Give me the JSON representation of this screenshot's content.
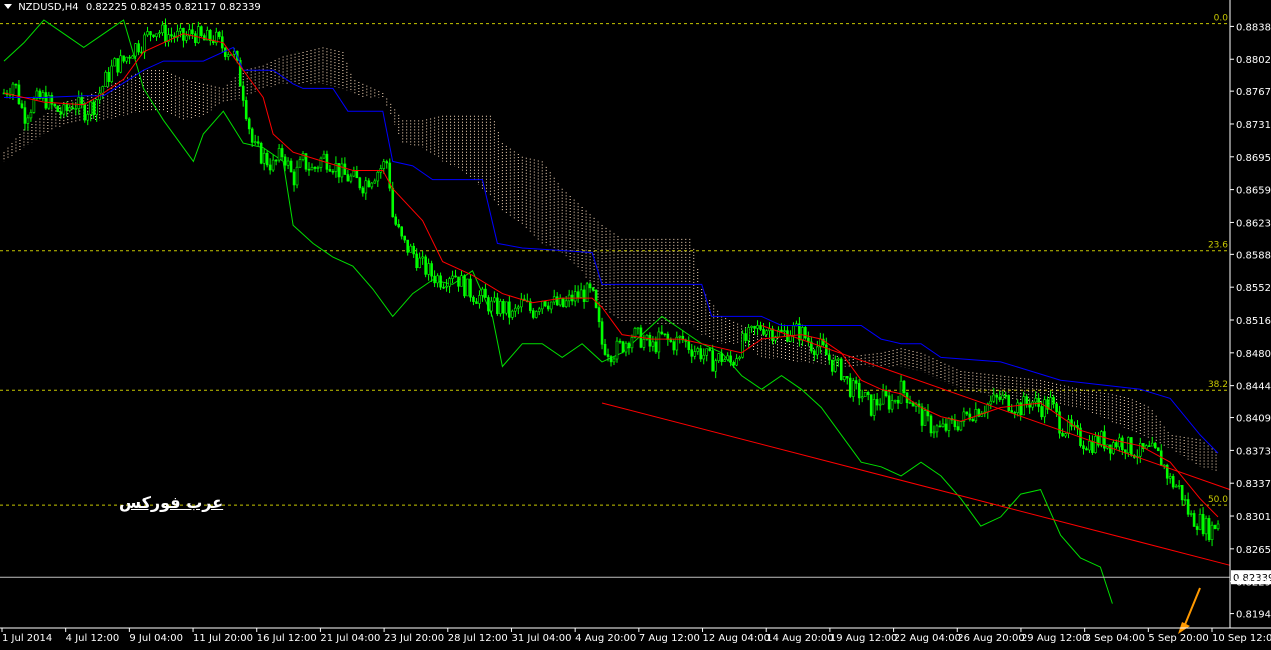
{
  "header": {
    "symbol": "NZDUSD,H4",
    "ohlc": "0.82225 0.82435 0.82117 0.82339"
  },
  "watermark": "عرب فوركس",
  "colors": {
    "background": "#000000",
    "candles": "#00ff00",
    "tenkan": "#ff0000",
    "kijun": "#0000ff",
    "chikou": "#00e000",
    "kumo": "#ffe0c0",
    "fib": "#c8c800",
    "channel": "#ff0000",
    "arrow": "#ff9900",
    "price_line": "#c0c0c0"
  },
  "chart_data": {
    "type": "candlestick",
    "title": "",
    "xlabel": "",
    "ylabel": "",
    "ylim": [
      0.8176,
      0.8856
    ],
    "y_ticks": [
      "0.88380",
      "0.88020",
      "0.87670",
      "0.87310",
      "0.86950",
      "0.86590",
      "0.86230",
      "0.85880",
      "0.85520",
      "0.85160",
      "0.84800",
      "0.84440",
      "0.84090",
      "0.83730",
      "0.83370",
      "0.83010",
      "0.82650",
      "0.82290",
      "0.81940"
    ],
    "x_ticks": [
      "1 Jul 2014",
      "4 Jul 12:00",
      "9 Jul 04:00",
      "11 Jul 20:00",
      "16 Jul 12:00",
      "21 Jul 04:00",
      "23 Jul 20:00",
      "28 Jul 12:00",
      "31 Jul 04:00",
      "4 Aug 20:00",
      "7 Aug 12:00",
      "12 Aug 04:00",
      "14 Aug 20:00",
      "19 Aug 12:00",
      "22 Aug 04:00",
      "26 Aug 20:00",
      "29 Aug 12:00",
      "3 Sep 04:00",
      "5 Sep 20:00",
      "10 Sep 12:00"
    ],
    "current_price": "0.82339",
    "fib_levels": [
      {
        "label": "0.0",
        "value": 0.8841
      },
      {
        "label": "23.6",
        "value": 0.8592
      },
      {
        "label": "38.2",
        "value": 0.8439
      },
      {
        "label": "50.0",
        "value": 0.8313
      }
    ],
    "close_path": [
      [
        0,
        0.8765
      ],
      [
        10,
        0.8778
      ],
      [
        20,
        0.874
      ],
      [
        30,
        0.8755
      ],
      [
        40,
        0.876
      ],
      [
        50,
        0.8748
      ],
      [
        60,
        0.8742
      ],
      [
        70,
        0.8755
      ],
      [
        80,
        0.8745
      ],
      [
        90,
        0.8752
      ],
      [
        100,
        0.8775
      ],
      [
        110,
        0.8795
      ],
      [
        120,
        0.88
      ],
      [
        130,
        0.8815
      ],
      [
        140,
        0.8822
      ],
      [
        150,
        0.8836
      ],
      [
        160,
        0.883
      ],
      [
        170,
        0.8828
      ],
      [
        180,
        0.8824
      ],
      [
        190,
        0.8832
      ],
      [
        200,
        0.8822
      ],
      [
        210,
        0.8826
      ],
      [
        220,
        0.8815
      ],
      [
        230,
        0.881
      ],
      [
        240,
        0.8765
      ],
      [
        250,
        0.8705
      ],
      [
        260,
        0.8695
      ],
      [
        270,
        0.8685
      ],
      [
        280,
        0.87
      ],
      [
        290,
        0.867
      ],
      [
        300,
        0.869
      ],
      [
        310,
        0.868
      ],
      [
        320,
        0.8695
      ],
      [
        330,
        0.8688
      ],
      [
        340,
        0.8675
      ],
      [
        350,
        0.867
      ],
      [
        360,
        0.8665
      ],
      [
        370,
        0.8675
      ],
      [
        380,
        0.8685
      ],
      [
        385,
        0.869
      ],
      [
        390,
        0.863
      ],
      [
        400,
        0.86
      ],
      [
        410,
        0.859
      ],
      [
        420,
        0.8575
      ],
      [
        430,
        0.8565
      ],
      [
        440,
        0.856
      ],
      [
        450,
        0.857
      ],
      [
        460,
        0.8555
      ],
      [
        470,
        0.8545
      ],
      [
        480,
        0.854
      ],
      [
        490,
        0.853
      ],
      [
        500,
        0.853
      ],
      [
        510,
        0.852
      ],
      [
        520,
        0.8535
      ],
      [
        530,
        0.8525
      ],
      [
        540,
        0.854
      ],
      [
        550,
        0.8535
      ],
      [
        560,
        0.853
      ],
      [
        570,
        0.854
      ],
      [
        580,
        0.8545
      ],
      [
        590,
        0.8545
      ],
      [
        600,
        0.849
      ],
      [
        610,
        0.848
      ],
      [
        620,
        0.8488
      ],
      [
        630,
        0.85
      ],
      [
        640,
        0.8495
      ],
      [
        650,
        0.8485
      ],
      [
        660,
        0.8497
      ],
      [
        670,
        0.849
      ],
      [
        680,
        0.8495
      ],
      [
        690,
        0.8485
      ],
      [
        700,
        0.848
      ],
      [
        710,
        0.847
      ],
      [
        720,
        0.8475
      ],
      [
        730,
        0.8468
      ],
      [
        740,
        0.849
      ],
      [
        750,
        0.85
      ],
      [
        760,
        0.851
      ],
      [
        770,
        0.8505
      ],
      [
        780,
        0.85
      ],
      [
        790,
        0.8505
      ],
      [
        800,
        0.8502
      ],
      [
        810,
        0.849
      ],
      [
        820,
        0.8485
      ],
      [
        830,
        0.847
      ],
      [
        840,
        0.846
      ],
      [
        850,
        0.844
      ],
      [
        860,
        0.8435
      ],
      [
        870,
        0.842
      ],
      [
        880,
        0.843
      ],
      [
        890,
        0.8425
      ],
      [
        900,
        0.844
      ],
      [
        910,
        0.843
      ],
      [
        920,
        0.841
      ],
      [
        930,
        0.84
      ],
      [
        940,
        0.8395
      ],
      [
        950,
        0.84
      ],
      [
        960,
        0.8405
      ],
      [
        970,
        0.8415
      ],
      [
        980,
        0.842
      ],
      [
        990,
        0.8425
      ],
      [
        1000,
        0.843
      ],
      [
        1010,
        0.8425
      ],
      [
        1020,
        0.842
      ],
      [
        1030,
        0.8428
      ],
      [
        1040,
        0.842
      ],
      [
        1050,
        0.8425
      ],
      [
        1060,
        0.84
      ],
      [
        1070,
        0.8395
      ],
      [
        1080,
        0.8385
      ],
      [
        1090,
        0.838
      ],
      [
        1100,
        0.8385
      ],
      [
        1110,
        0.838
      ],
      [
        1120,
        0.8384
      ],
      [
        1130,
        0.8375
      ],
      [
        1140,
        0.837
      ],
      [
        1150,
        0.8372
      ],
      [
        1160,
        0.8365
      ],
      [
        1170,
        0.834
      ],
      [
        1180,
        0.833
      ],
      [
        1190,
        0.83
      ],
      [
        1200,
        0.8295
      ],
      [
        1210,
        0.8285
      ],
      [
        1218,
        0.8295
      ]
    ],
    "tenkan": [
      [
        0,
        0.8765
      ],
      [
        40,
        0.8755
      ],
      [
        80,
        0.8752
      ],
      [
        100,
        0.8765
      ],
      [
        120,
        0.878
      ],
      [
        140,
        0.881
      ],
      [
        180,
        0.883
      ],
      [
        220,
        0.882
      ],
      [
        240,
        0.879
      ],
      [
        260,
        0.876
      ],
      [
        270,
        0.872
      ],
      [
        290,
        0.87
      ],
      [
        320,
        0.869
      ],
      [
        350,
        0.868
      ],
      [
        380,
        0.868
      ],
      [
        390,
        0.866
      ],
      [
        420,
        0.8625
      ],
      [
        440,
        0.858
      ],
      [
        470,
        0.8565
      ],
      [
        500,
        0.8545
      ],
      [
        530,
        0.8535
      ],
      [
        560,
        0.854
      ],
      [
        590,
        0.854
      ],
      [
        600,
        0.853
      ],
      [
        620,
        0.85
      ],
      [
        650,
        0.8495
      ],
      [
        680,
        0.8495
      ],
      [
        700,
        0.849
      ],
      [
        740,
        0.848
      ],
      [
        760,
        0.8495
      ],
      [
        800,
        0.85
      ],
      [
        820,
        0.8495
      ],
      [
        840,
        0.848
      ],
      [
        860,
        0.845
      ],
      [
        880,
        0.844
      ],
      [
        900,
        0.8435
      ],
      [
        920,
        0.842
      ],
      [
        940,
        0.841
      ],
      [
        960,
        0.8405
      ],
      [
        1000,
        0.842
      ],
      [
        1040,
        0.8425
      ],
      [
        1060,
        0.841
      ],
      [
        1080,
        0.8395
      ],
      [
        1110,
        0.8385
      ],
      [
        1140,
        0.8378
      ],
      [
        1170,
        0.836
      ],
      [
        1200,
        0.832
      ],
      [
        1218,
        0.83
      ]
    ],
    "kijun": [
      [
        0,
        0.876
      ],
      [
        40,
        0.876
      ],
      [
        80,
        0.8762
      ],
      [
        100,
        0.8762
      ],
      [
        140,
        0.879
      ],
      [
        160,
        0.88
      ],
      [
        200,
        0.88
      ],
      [
        230,
        0.8815
      ],
      [
        240,
        0.879
      ],
      [
        270,
        0.879
      ],
      [
        290,
        0.8775
      ],
      [
        300,
        0.877
      ],
      [
        330,
        0.877
      ],
      [
        345,
        0.8745
      ],
      [
        380,
        0.8745
      ],
      [
        390,
        0.869
      ],
      [
        410,
        0.8685
      ],
      [
        430,
        0.867
      ],
      [
        480,
        0.867
      ],
      [
        495,
        0.86
      ],
      [
        520,
        0.8595
      ],
      [
        590,
        0.859
      ],
      [
        600,
        0.8555
      ],
      [
        700,
        0.8555
      ],
      [
        710,
        0.852
      ],
      [
        760,
        0.852
      ],
      [
        780,
        0.851
      ],
      [
        860,
        0.851
      ],
      [
        880,
        0.8495
      ],
      [
        900,
        0.849
      ],
      [
        920,
        0.849
      ],
      [
        940,
        0.8475
      ],
      [
        1000,
        0.847
      ],
      [
        1060,
        0.845
      ],
      [
        1100,
        0.8445
      ],
      [
        1140,
        0.844
      ],
      [
        1170,
        0.843
      ],
      [
        1200,
        0.839
      ],
      [
        1218,
        0.837
      ]
    ],
    "chikou": [
      [
        0,
        0.88
      ],
      [
        20,
        0.882
      ],
      [
        40,
        0.8845
      ],
      [
        60,
        0.883
      ],
      [
        80,
        0.8815
      ],
      [
        100,
        0.883
      ],
      [
        120,
        0.8845
      ],
      [
        140,
        0.877
      ],
      [
        160,
        0.8735
      ],
      [
        180,
        0.8705
      ],
      [
        190,
        0.869
      ],
      [
        200,
        0.872
      ],
      [
        220,
        0.8745
      ],
      [
        240,
        0.871
      ],
      [
        260,
        0.8705
      ],
      [
        280,
        0.869
      ],
      [
        290,
        0.862
      ],
      [
        310,
        0.86
      ],
      [
        330,
        0.8585
      ],
      [
        350,
        0.8575
      ],
      [
        370,
        0.855
      ],
      [
        390,
        0.852
      ],
      [
        410,
        0.8545
      ],
      [
        430,
        0.856
      ],
      [
        450,
        0.8555
      ],
      [
        470,
        0.857
      ],
      [
        490,
        0.852
      ],
      [
        500,
        0.8465
      ],
      [
        520,
        0.849
      ],
      [
        540,
        0.849
      ],
      [
        560,
        0.8475
      ],
      [
        580,
        0.849
      ],
      [
        600,
        0.847
      ],
      [
        620,
        0.848
      ],
      [
        640,
        0.85
      ],
      [
        660,
        0.852
      ],
      [
        680,
        0.8505
      ],
      [
        700,
        0.849
      ],
      [
        720,
        0.848
      ],
      [
        740,
        0.8455
      ],
      [
        760,
        0.844
      ],
      [
        780,
        0.8455
      ],
      [
        800,
        0.844
      ],
      [
        820,
        0.842
      ],
      [
        840,
        0.839
      ],
      [
        860,
        0.836
      ],
      [
        880,
        0.8355
      ],
      [
        900,
        0.8345
      ],
      [
        920,
        0.836
      ],
      [
        940,
        0.8345
      ],
      [
        960,
        0.832
      ],
      [
        980,
        0.829
      ],
      [
        1000,
        0.83
      ],
      [
        1020,
        0.8325
      ],
      [
        1040,
        0.833
      ],
      [
        1060,
        0.828
      ],
      [
        1080,
        0.8255
      ],
      [
        1100,
        0.8245
      ],
      [
        1112,
        0.8205
      ]
    ],
    "kumo": [
      [
        0,
        0.869,
        0.87
      ],
      [
        20,
        0.8705,
        0.8725
      ],
      [
        40,
        0.872,
        0.874
      ],
      [
        60,
        0.873,
        0.8755
      ],
      [
        80,
        0.8735,
        0.876
      ],
      [
        100,
        0.8735,
        0.877
      ],
      [
        120,
        0.874,
        0.878
      ],
      [
        140,
        0.8745,
        0.879
      ],
      [
        160,
        0.8745,
        0.879
      ],
      [
        180,
        0.8735,
        0.878
      ],
      [
        200,
        0.874,
        0.8775
      ],
      [
        220,
        0.8755,
        0.877
      ],
      [
        240,
        0.876,
        0.879
      ],
      [
        260,
        0.877,
        0.8795
      ],
      [
        280,
        0.8775,
        0.8805
      ],
      [
        300,
        0.8775,
        0.881
      ],
      [
        320,
        0.8775,
        0.8815
      ],
      [
        340,
        0.877,
        0.881
      ],
      [
        350,
        0.8765,
        0.878
      ],
      [
        360,
        0.876,
        0.8775
      ],
      [
        380,
        0.876,
        0.8765
      ],
      [
        400,
        0.871,
        0.8735
      ],
      [
        420,
        0.8705,
        0.8735
      ],
      [
        440,
        0.869,
        0.874
      ],
      [
        460,
        0.868,
        0.874
      ],
      [
        490,
        0.865,
        0.874
      ],
      [
        500,
        0.8635,
        0.871
      ],
      [
        520,
        0.862,
        0.8695
      ],
      [
        540,
        0.86,
        0.869
      ],
      [
        560,
        0.859,
        0.866
      ],
      [
        580,
        0.857,
        0.864
      ],
      [
        600,
        0.853,
        0.862
      ],
      [
        620,
        0.8515,
        0.8605
      ],
      [
        660,
        0.851,
        0.8605
      ],
      [
        690,
        0.851,
        0.8605
      ],
      [
        700,
        0.85,
        0.855
      ],
      [
        720,
        0.849,
        0.852
      ],
      [
        740,
        0.849,
        0.851
      ],
      [
        760,
        0.8475,
        0.85
      ],
      [
        800,
        0.847,
        0.849
      ],
      [
        840,
        0.8465,
        0.8475
      ],
      [
        880,
        0.8465,
        0.848
      ],
      [
        900,
        0.8465,
        0.8485
      ],
      [
        920,
        0.846,
        0.848
      ],
      [
        940,
        0.845,
        0.847
      ],
      [
        960,
        0.844,
        0.846
      ],
      [
        1000,
        0.843,
        0.8455
      ],
      [
        1040,
        0.8425,
        0.845
      ],
      [
        1080,
        0.842,
        0.844
      ],
      [
        1110,
        0.8405,
        0.8435
      ],
      [
        1130,
        0.8395,
        0.843
      ],
      [
        1150,
        0.8385,
        0.842
      ],
      [
        1170,
        0.8375,
        0.839
      ],
      [
        1200,
        0.8355,
        0.8385
      ],
      [
        1218,
        0.835,
        0.837
      ]
    ],
    "channel_upper": [
      [
        760,
        0.851
      ],
      [
        1230,
        0.833
      ]
    ],
    "channel_lower": [
      [
        600,
        0.8425
      ],
      [
        1230,
        0.8247
      ]
    ]
  }
}
